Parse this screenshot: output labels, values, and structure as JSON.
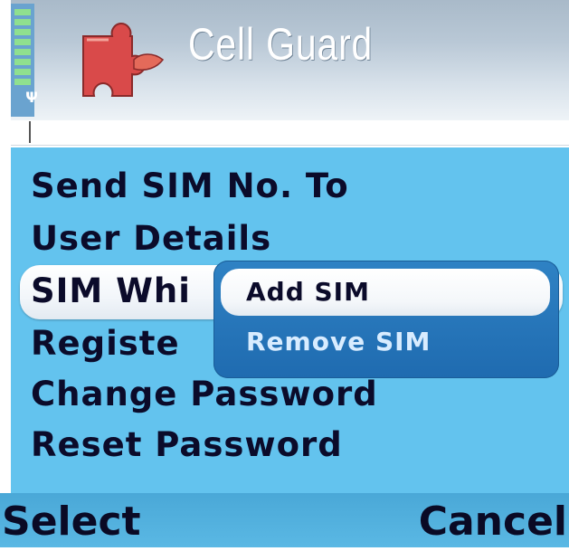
{
  "header": {
    "app_title": "Cell Guard",
    "icon": "puzzle-piece-icon",
    "signal_icon": "antenna-icon"
  },
  "menu": {
    "items": [
      {
        "label": "Send SIM No. To"
      },
      {
        "label": "User Details"
      },
      {
        "label": "SIM Whi"
      },
      {
        "label": "Registe"
      },
      {
        "label": "Change Password"
      },
      {
        "label": "Reset Password"
      }
    ]
  },
  "submenu": {
    "items": [
      {
        "label": "Add SIM",
        "selected": true
      },
      {
        "label": "Remove SIM",
        "selected": false
      }
    ]
  },
  "softkeys": {
    "left": "Select",
    "right": "Cancel"
  },
  "colors": {
    "list_background": "#63c3ee",
    "submenu_background": "#1f6bb0",
    "submenu_text": "#d8ecff",
    "text_dark": "#0b0b2a",
    "signal_bars": "#8fe08f"
  }
}
